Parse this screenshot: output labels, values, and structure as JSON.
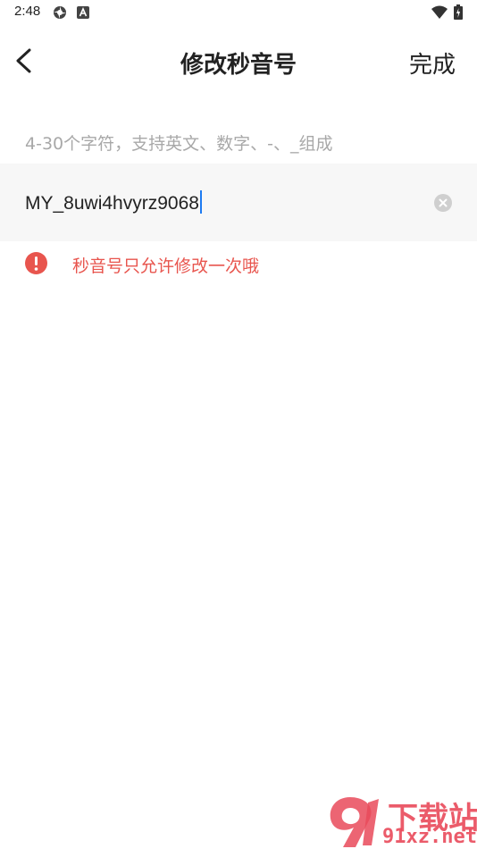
{
  "status_bar": {
    "time": "2:48",
    "icons": [
      "gear-icon",
      "a-badge-icon",
      "wifi-icon",
      "battery-icon"
    ]
  },
  "header": {
    "back_icon": "chevron-left-icon",
    "title": "修改秒音号",
    "done_label": "完成"
  },
  "form": {
    "hint": "4-30个字符，支持英文、数字、-、_组成",
    "id_value": "MY_8uwi4hvyrz9068",
    "clear_icon": "clear-circle-icon"
  },
  "warning": {
    "icon": "exclamation-circle-icon",
    "text": "秒音号只允许修改一次哦",
    "color": "#e8554e"
  },
  "watermark": {
    "title": "下载站",
    "url": "91xz.net",
    "color": "#e94a5a"
  },
  "colors": {
    "accent_caret": "#1e7bf2",
    "input_bg": "#f7f7f7",
    "hint": "#a8a8a8"
  }
}
